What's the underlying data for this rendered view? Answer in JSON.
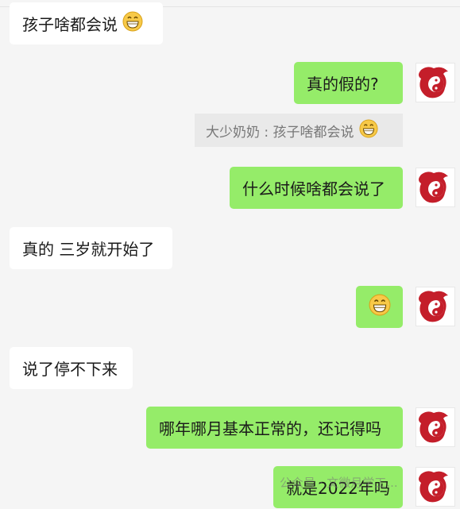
{
  "messages": [
    {
      "text": "孩子啥都会说",
      "emoji": "grinning-emoji"
    },
    {
      "text": "真的假的?"
    },
    {
      "quote": "大少奶奶 : 孩子啥都会说",
      "emoji": "grinning-emoji"
    },
    {
      "text": "什么时候啥都会说了"
    },
    {
      "text": "真的 三岁就开始了"
    },
    {
      "emoji": "grinning-emoji"
    },
    {
      "text": "说了停不下来"
    },
    {
      "text": "哪年哪月基本正常的，还记得吗"
    },
    {
      "text": "就是2022年吗"
    }
  ],
  "watermark": "公众号 · 文微月学工...",
  "colors": {
    "incoming": "#ffffff",
    "outgoing": "#95ec69",
    "background": "#f5f5f5"
  }
}
